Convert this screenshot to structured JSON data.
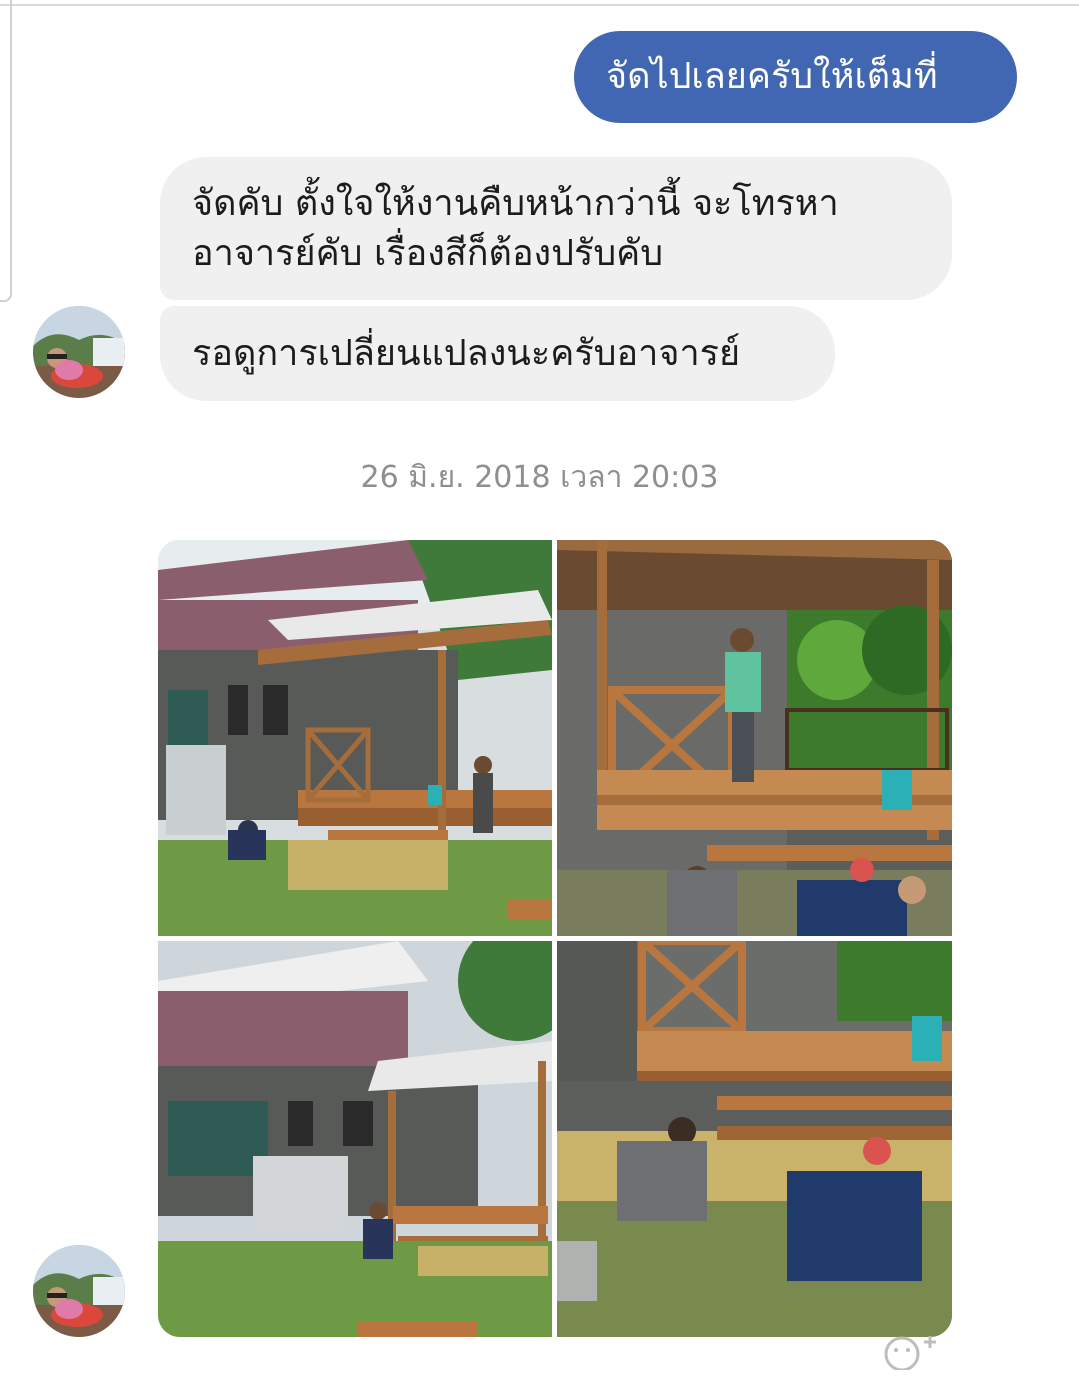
{
  "messages": [
    {
      "direction": "outgoing",
      "text": "จัดไปเลยครับให้เต็มที่"
    },
    {
      "direction": "incoming",
      "text": "จัดคับ ตั้งใจให้งานคืบหน้ากว่านี้ จะโทรหา\nอาจารย์คับ เรื่องสีก็ต้องปรับคับ"
    },
    {
      "direction": "incoming",
      "text": "รอดูการเปลี่ยนแปลงนะครับอาจารย์"
    }
  ],
  "timestamp": "26 มิ.ย. 2018 เวลา 20:03",
  "colors": {
    "outgoing_bubble": "#4267b2",
    "incoming_bubble": "#f0f0f0",
    "timestamp_text": "#8e8e93"
  },
  "photos": [
    {
      "subject": "house-with-wooden-deck-construction"
    },
    {
      "subject": "deck-closeup-workers"
    },
    {
      "subject": "house-side-view"
    },
    {
      "subject": "deck-steps-workers"
    }
  ],
  "reaction_icon": "add-reaction-icon"
}
